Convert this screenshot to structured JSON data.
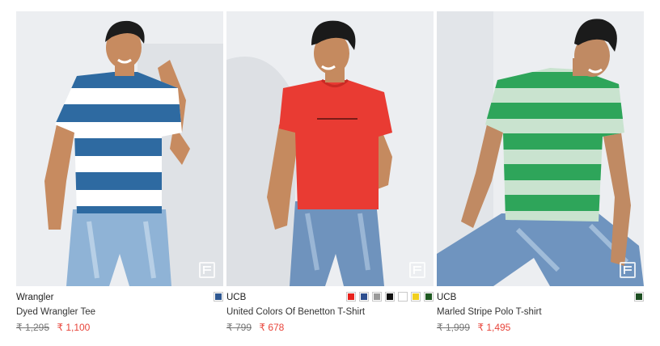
{
  "products": [
    {
      "brand": "Wrangler",
      "name": "Dyed Wrangler Tee",
      "old_price": "₹ 1,295",
      "price": "₹ 1,100",
      "swatches": [
        "#2f5891"
      ]
    },
    {
      "brand": "UCB",
      "name": "United Colors Of Benetton T-Shirt",
      "old_price": "₹ 799",
      "price": "₹ 678",
      "swatches": [
        "#e8231d",
        "#2e4f8f",
        "#9a9a9a",
        "#111111",
        "#ffffff",
        "#f1cf1e",
        "#1f5a21"
      ]
    },
    {
      "brand": "UCB",
      "name": "Marled Stripe Polo T-shirt",
      "old_price": "₹ 1,999",
      "price": "₹ 1,495",
      "swatches": [
        "#1d4f22"
      ]
    }
  ],
  "colors": {
    "sale_price": "#e8443a",
    "old_price": "#777777"
  },
  "icons": {
    "watermark": "f-logo-icon"
  }
}
